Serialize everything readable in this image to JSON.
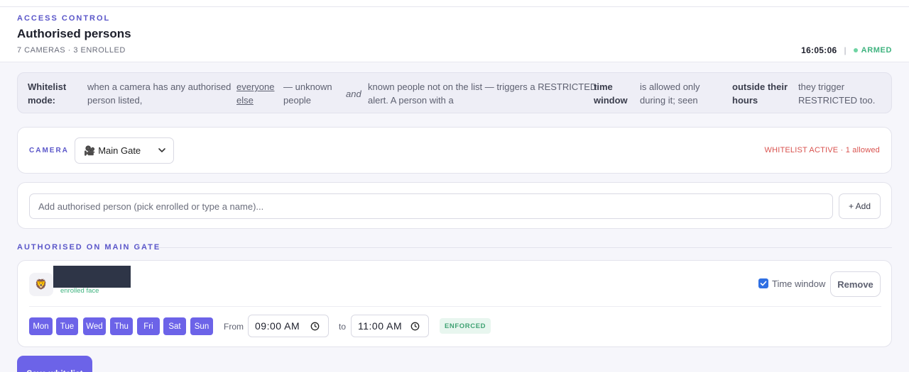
{
  "header": {
    "eyebrow": "ACCESS CONTROL",
    "title": "Authorised persons",
    "subtitle": "7 CAMERAS · 3 ENROLLED",
    "clock": "16:05:06",
    "separator": "|",
    "armed_label": "ARMED"
  },
  "info": {
    "label_line1": "Whitelist",
    "label_line2": "mode:",
    "c1_line1": "when a camera has any authorised",
    "c1_line2": "person listed,",
    "c2_line1": "everyone",
    "c2_line2": "else",
    "c3_line1": "— unknown",
    "c3_line2": "people",
    "c4": "and",
    "c5_line1": "known people not on the list — triggers a RESTRICTED",
    "c5_line2": "alert. A person with a",
    "c6_line1": "time",
    "c6_line2": "window",
    "c7_line1": "is allowed only",
    "c7_line2": "during it; seen",
    "c8_line1": "outside their",
    "c8_line2": "hours",
    "c9_line1": "they trigger",
    "c9_line2": "RESTRICTED too."
  },
  "camera": {
    "label": "CAMERA",
    "icon": "🎥",
    "selected": "Main Gate",
    "status": "WHITELIST ACTIVE · 1 allowed"
  },
  "add": {
    "placeholder": "Add authorised person (pick enrolled or type a name)...",
    "button_label": "+ Add"
  },
  "section": {
    "title": "AUTHORISED ON MAIN GATE"
  },
  "person": {
    "avatar_icon": "🦁",
    "face_tag": "enrolled face",
    "time_window_label": "Time window",
    "time_window_checked": true,
    "remove_label": "Remove",
    "days": [
      "Mon",
      "Tue",
      "Wed",
      "Thu",
      "Fri",
      "Sat",
      "Sun"
    ],
    "from_label": "From",
    "from_time": "09:00 AM",
    "to_label": "to",
    "to_time": "11:00 AM",
    "enforced_badge": "ENFORCED"
  },
  "footer": {
    "save_label": "Save whitelist"
  },
  "colors": {
    "accent": "#6c63e8",
    "armed": "#3fb37f",
    "restricted": "#d9534f",
    "checkbox": "#2f6fe3"
  }
}
